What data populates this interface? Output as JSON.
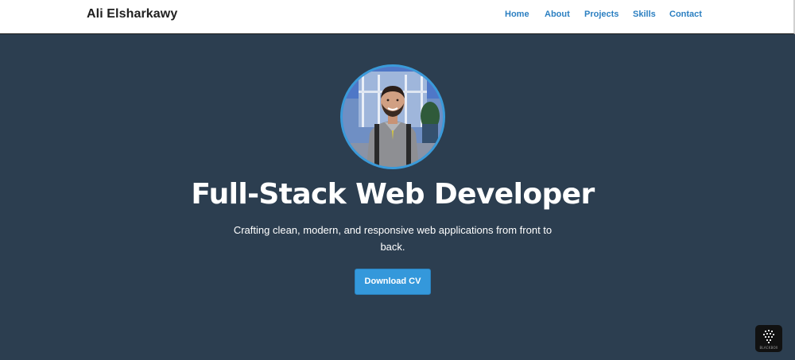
{
  "header": {
    "brand": "Ali Elsharkawy",
    "nav": [
      {
        "label": "Home"
      },
      {
        "label": "About"
      },
      {
        "label": "Projects"
      },
      {
        "label": "Skills"
      },
      {
        "label": "Contact"
      }
    ]
  },
  "hero": {
    "avatar_icon": "profile-photo",
    "title": "Full-Stack Web Developer",
    "subtitle": "Crafting clean, modern, and responsive web applications from front to back.",
    "cta_label": "Download CV"
  },
  "widget": {
    "label": "BLACKBOX",
    "icon": "blackbox-logo-icon"
  },
  "colors": {
    "hero_background": "#2c3e50",
    "accent": "#3498db",
    "nav_link": "#2b7fc1"
  }
}
